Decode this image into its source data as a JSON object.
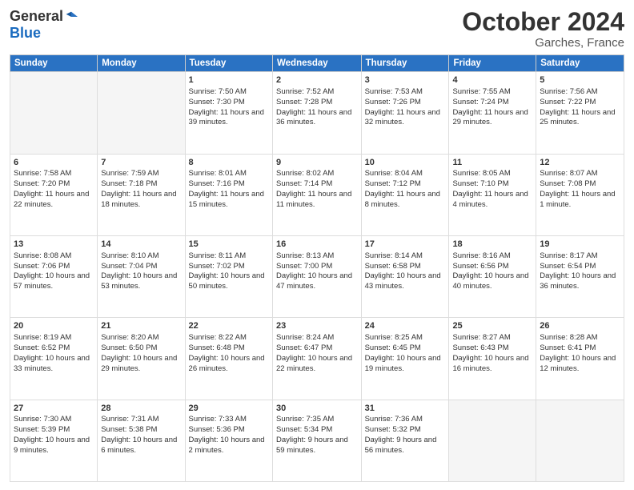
{
  "logo": {
    "general": "General",
    "blue": "Blue"
  },
  "title": "October 2024",
  "location": "Garches, France",
  "days_of_week": [
    "Sunday",
    "Monday",
    "Tuesday",
    "Wednesday",
    "Thursday",
    "Friday",
    "Saturday"
  ],
  "weeks": [
    [
      {
        "day": "",
        "info": ""
      },
      {
        "day": "",
        "info": ""
      },
      {
        "day": "1",
        "info": "Sunrise: 7:50 AM\nSunset: 7:30 PM\nDaylight: 11 hours and 39 minutes."
      },
      {
        "day": "2",
        "info": "Sunrise: 7:52 AM\nSunset: 7:28 PM\nDaylight: 11 hours and 36 minutes."
      },
      {
        "day": "3",
        "info": "Sunrise: 7:53 AM\nSunset: 7:26 PM\nDaylight: 11 hours and 32 minutes."
      },
      {
        "day": "4",
        "info": "Sunrise: 7:55 AM\nSunset: 7:24 PM\nDaylight: 11 hours and 29 minutes."
      },
      {
        "day": "5",
        "info": "Sunrise: 7:56 AM\nSunset: 7:22 PM\nDaylight: 11 hours and 25 minutes."
      }
    ],
    [
      {
        "day": "6",
        "info": "Sunrise: 7:58 AM\nSunset: 7:20 PM\nDaylight: 11 hours and 22 minutes."
      },
      {
        "day": "7",
        "info": "Sunrise: 7:59 AM\nSunset: 7:18 PM\nDaylight: 11 hours and 18 minutes."
      },
      {
        "day": "8",
        "info": "Sunrise: 8:01 AM\nSunset: 7:16 PM\nDaylight: 11 hours and 15 minutes."
      },
      {
        "day": "9",
        "info": "Sunrise: 8:02 AM\nSunset: 7:14 PM\nDaylight: 11 hours and 11 minutes."
      },
      {
        "day": "10",
        "info": "Sunrise: 8:04 AM\nSunset: 7:12 PM\nDaylight: 11 hours and 8 minutes."
      },
      {
        "day": "11",
        "info": "Sunrise: 8:05 AM\nSunset: 7:10 PM\nDaylight: 11 hours and 4 minutes."
      },
      {
        "day": "12",
        "info": "Sunrise: 8:07 AM\nSunset: 7:08 PM\nDaylight: 11 hours and 1 minute."
      }
    ],
    [
      {
        "day": "13",
        "info": "Sunrise: 8:08 AM\nSunset: 7:06 PM\nDaylight: 10 hours and 57 minutes."
      },
      {
        "day": "14",
        "info": "Sunrise: 8:10 AM\nSunset: 7:04 PM\nDaylight: 10 hours and 53 minutes."
      },
      {
        "day": "15",
        "info": "Sunrise: 8:11 AM\nSunset: 7:02 PM\nDaylight: 10 hours and 50 minutes."
      },
      {
        "day": "16",
        "info": "Sunrise: 8:13 AM\nSunset: 7:00 PM\nDaylight: 10 hours and 47 minutes."
      },
      {
        "day": "17",
        "info": "Sunrise: 8:14 AM\nSunset: 6:58 PM\nDaylight: 10 hours and 43 minutes."
      },
      {
        "day": "18",
        "info": "Sunrise: 8:16 AM\nSunset: 6:56 PM\nDaylight: 10 hours and 40 minutes."
      },
      {
        "day": "19",
        "info": "Sunrise: 8:17 AM\nSunset: 6:54 PM\nDaylight: 10 hours and 36 minutes."
      }
    ],
    [
      {
        "day": "20",
        "info": "Sunrise: 8:19 AM\nSunset: 6:52 PM\nDaylight: 10 hours and 33 minutes."
      },
      {
        "day": "21",
        "info": "Sunrise: 8:20 AM\nSunset: 6:50 PM\nDaylight: 10 hours and 29 minutes."
      },
      {
        "day": "22",
        "info": "Sunrise: 8:22 AM\nSunset: 6:48 PM\nDaylight: 10 hours and 26 minutes."
      },
      {
        "day": "23",
        "info": "Sunrise: 8:24 AM\nSunset: 6:47 PM\nDaylight: 10 hours and 22 minutes."
      },
      {
        "day": "24",
        "info": "Sunrise: 8:25 AM\nSunset: 6:45 PM\nDaylight: 10 hours and 19 minutes."
      },
      {
        "day": "25",
        "info": "Sunrise: 8:27 AM\nSunset: 6:43 PM\nDaylight: 10 hours and 16 minutes."
      },
      {
        "day": "26",
        "info": "Sunrise: 8:28 AM\nSunset: 6:41 PM\nDaylight: 10 hours and 12 minutes."
      }
    ],
    [
      {
        "day": "27",
        "info": "Sunrise: 7:30 AM\nSunset: 5:39 PM\nDaylight: 10 hours and 9 minutes."
      },
      {
        "day": "28",
        "info": "Sunrise: 7:31 AM\nSunset: 5:38 PM\nDaylight: 10 hours and 6 minutes."
      },
      {
        "day": "29",
        "info": "Sunrise: 7:33 AM\nSunset: 5:36 PM\nDaylight: 10 hours and 2 minutes."
      },
      {
        "day": "30",
        "info": "Sunrise: 7:35 AM\nSunset: 5:34 PM\nDaylight: 9 hours and 59 minutes."
      },
      {
        "day": "31",
        "info": "Sunrise: 7:36 AM\nSunset: 5:32 PM\nDaylight: 9 hours and 56 minutes."
      },
      {
        "day": "",
        "info": ""
      },
      {
        "day": "",
        "info": ""
      }
    ]
  ]
}
